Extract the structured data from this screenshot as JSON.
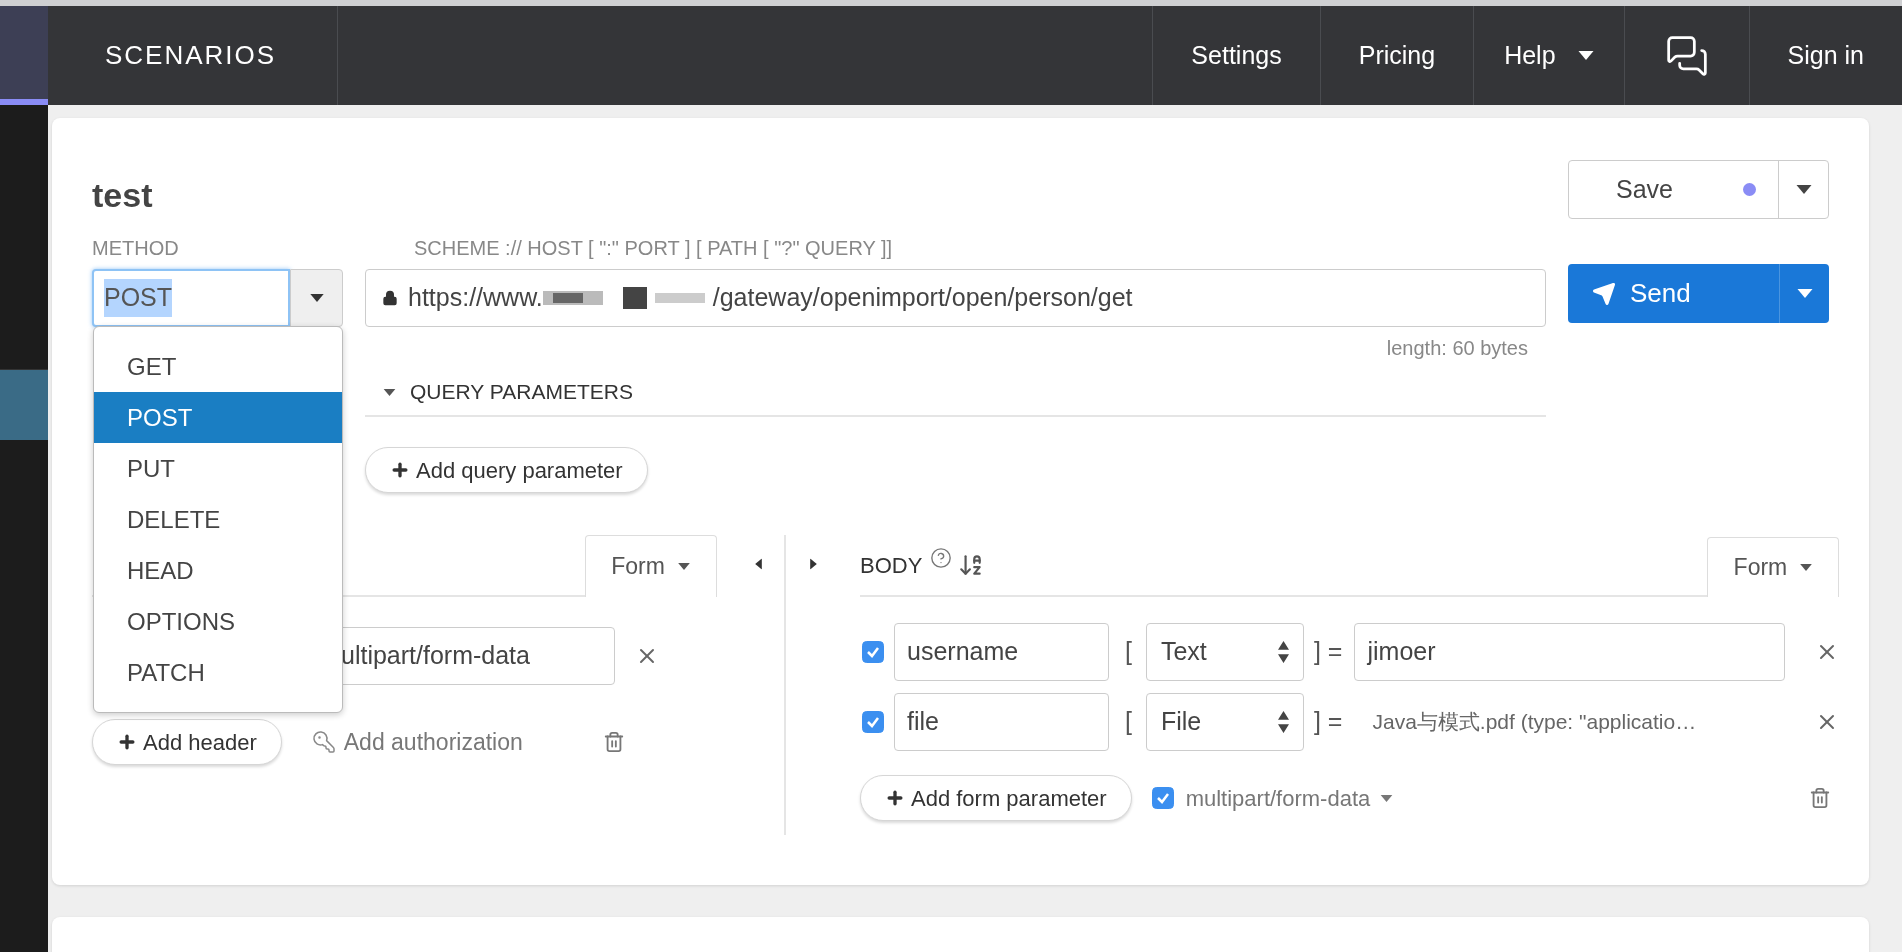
{
  "nav": {
    "title": "SCENARIOS",
    "items": [
      {
        "kind": "text",
        "label": "Settings"
      },
      {
        "kind": "text",
        "label": "Pricing"
      },
      {
        "kind": "dropdown",
        "label": "Help"
      },
      {
        "kind": "chat"
      },
      {
        "kind": "text",
        "label": "Sign in"
      }
    ]
  },
  "request": {
    "title": "test",
    "save": {
      "label": "Save",
      "unsaved": true
    },
    "method_label": "METHOD",
    "method": "POST",
    "url_label": "SCHEME :// HOST [ \":\" PORT ] [ PATH [ \"?\" QUERY ]]",
    "url_start": "https://www.",
    "url_end": "/gateway/openimport/open/person/get",
    "length": "length: 60 bytes",
    "send": "Send",
    "query": {
      "title": "QUERY PARAMETERS",
      "expanded": true,
      "add": "Add query parameter"
    },
    "headers": {
      "mode": "Form",
      "value": "ultipart/form-data",
      "add": "Add header",
      "auth": "Add authorization"
    },
    "body": {
      "title": "BODY",
      "mode": "Form",
      "rows": [
        {
          "kind": "text",
          "enabled": true,
          "name": "username",
          "open": "[",
          "type": "Text",
          "close": "] =",
          "value": "jimoer"
        },
        {
          "kind": "file",
          "enabled": true,
          "name": "file",
          "open": "[",
          "type": "File",
          "close": "] =",
          "value": "Java与模式.pdf (type: \"applicatio…"
        }
      ],
      "add": "Add form parameter",
      "multipart": {
        "checked": true,
        "label": "multipart/form-data"
      }
    },
    "method_menu": [
      {
        "label": "GET",
        "selected": false
      },
      {
        "label": "POST",
        "selected": true
      },
      {
        "label": "PUT",
        "selected": false
      },
      {
        "label": "DELETE",
        "selected": false
      },
      {
        "label": "HEAD",
        "selected": false
      },
      {
        "label": "OPTIONS",
        "selected": false
      },
      {
        "label": "PATCH",
        "selected": false
      }
    ]
  }
}
